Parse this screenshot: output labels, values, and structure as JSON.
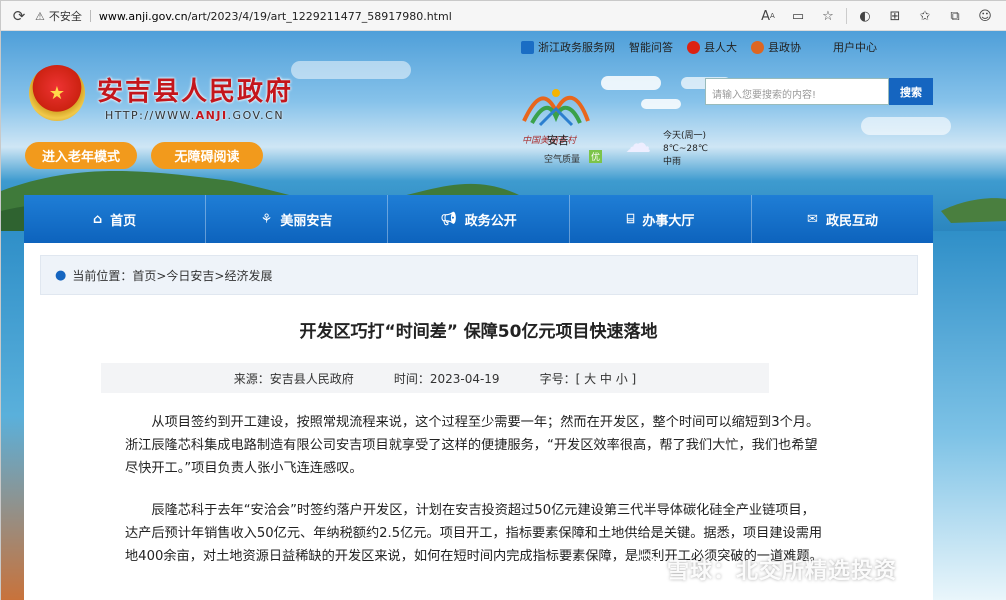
{
  "browser": {
    "security_label": "不安全",
    "url_prefix": "www.anji.gov.cn",
    "url_path": "/art/2023/4/19/art_1229211477_58917980.html"
  },
  "header": {
    "site_title": "安吉县人民政府",
    "site_url_pre": "HTTP://WWW.",
    "site_url_brand": "ANJI",
    "site_url_post": ".GOV.CN",
    "elder_mode": "进入老年模式",
    "accessible": "无障碍阅读",
    "top_links": [
      "浙江政务服务网",
      "智能问答",
      "县人大",
      "县政协",
      "用户中心"
    ],
    "logo_caption": "中国美丽乡村",
    "search_placeholder": "请输入您要搜索的内容!",
    "search_button": "搜索",
    "location": "安吉",
    "air_quality_label": "空气质量",
    "air_quality_value": "优",
    "weather_today": "今天(周一)",
    "weather_temp": "8℃~28℃",
    "weather_cond": "中雨"
  },
  "nav": {
    "items": [
      {
        "label": "首页",
        "icon": "home-icon"
      },
      {
        "label": "美丽安吉",
        "icon": "bamboo-icon"
      },
      {
        "label": "政务公开",
        "icon": "megaphone-icon"
      },
      {
        "label": "办事大厅",
        "icon": "building-icon"
      },
      {
        "label": "政民互动",
        "icon": "mail-icon"
      }
    ]
  },
  "breadcrumb": {
    "label": "当前位置：",
    "path": "首页>今日安吉>经济发展"
  },
  "article": {
    "title": "开发区巧打“时间差” 保障50亿元项目快速落地",
    "source_label": "来源：",
    "source": "安吉县人民政府",
    "time_label": "时间：",
    "time": "2023-04-19",
    "font_label": "字号：",
    "font_sizes": "[ 大 中 小 ]",
    "para1": "从项目签约到开工建设，按照常规流程来说，这个过程至少需要一年；然而在开发区，整个时间可以缩短到3个月。浙江辰隆芯科集成电路制造有限公司安吉项目就享受了这样的便捷服务，“开发区效率很高，帮了我们大忙，我们也希望尽快开工。”项目负责人张小飞连连感叹。",
    "para2": "辰隆芯科于去年“安洽会”时签约落户开发区，计划在安吉投资超过50亿元建设第三代半导体碳化硅全产业链项目，达产后预计年销售收入50亿元、年纳税额约2.5亿元。项目开工，指标要素保障和土地供给是关键。据悉，项目建设需用地400余亩，对土地资源日益稀缺的开发区来说，如何在短时间内完成指标要素保障，是顺利开工必须突破的一道难题。"
  },
  "watermark": "雪球：北交所精选投资",
  "colors": {
    "nav_blue": "#0d63bd",
    "title_red": "#c4161c",
    "pill_orange": "#f29a1c",
    "search_blue": "#1565c0"
  }
}
